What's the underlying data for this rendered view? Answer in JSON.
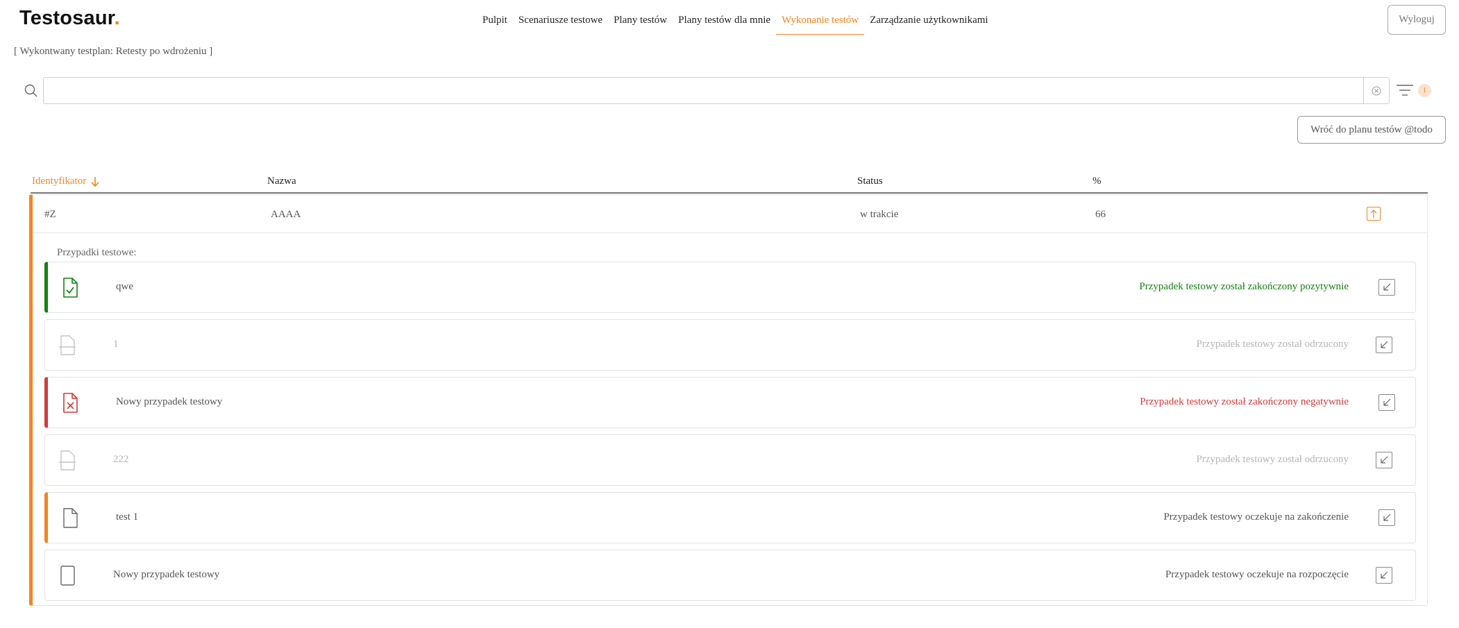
{
  "header": {
    "logo_text": "Testosaur",
    "logo_dot": ".",
    "nav": [
      {
        "label": "Pulpit"
      },
      {
        "label": "Scenariusze testowe"
      },
      {
        "label": "Plany testów"
      },
      {
        "label": "Plany testów dla mnie"
      },
      {
        "label": "Wykonanie testów"
      },
      {
        "label": "Zarządzanie użytkownikami"
      }
    ],
    "active_nav": "Wykonanie testów",
    "logout_label": "Wyloguj"
  },
  "plan_label": "[ Wykontwany testplan: Retesty po wdrożeniu ]",
  "search": {
    "value": "",
    "placeholder": "",
    "filter_count": "1"
  },
  "back_button_label": "Wróć do planu testów @todo",
  "table": {
    "columns": {
      "id": "Identyfikator",
      "name": "Nazwa",
      "status": "Status",
      "percent": "%"
    },
    "row": {
      "id": "#Z",
      "name": "AAAA",
      "status": "w trakcie",
      "percent": "66"
    },
    "cases_label": "Przypadki testowe:",
    "cases": [
      {
        "name": "qwe",
        "status": "Przypadek testowy został zakończony pozytywnie",
        "state": "passed",
        "color": "#128212"
      },
      {
        "name": "1",
        "status": "Przypadek testowy został odrzucony",
        "state": "rejected",
        "color": "#b5b5b5"
      },
      {
        "name": "Nowy przypadek testowy",
        "status": "Przypadek testowy został zakończony negatywnie",
        "state": "failed",
        "color": "#d33a3a"
      },
      {
        "name": "222",
        "status": "Przypadek testowy został odrzucony",
        "state": "rejected",
        "color": "#b5b5b5"
      },
      {
        "name": "test 1",
        "status": "Przypadek testowy oczekuje na zakończenie",
        "state": "in-progress",
        "color": "#f5841f"
      },
      {
        "name": "Nowy przypadek testowy",
        "status": "Przypadek testowy oczekuje na rozpoczęcie",
        "state": "not-started",
        "color": "#555555"
      }
    ]
  },
  "colors": {
    "accent": "#f5841f",
    "passed": "#128212",
    "failed": "#d33a3a",
    "muted": "#b5b5b5"
  }
}
